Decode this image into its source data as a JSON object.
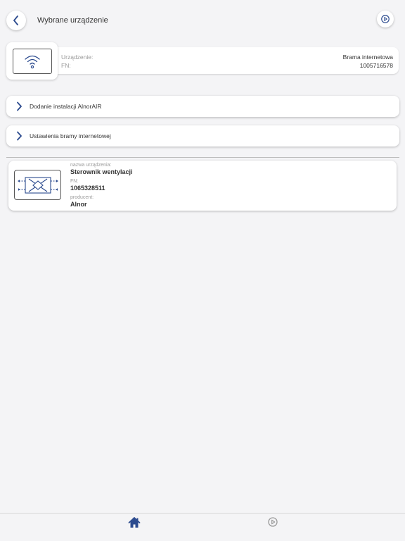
{
  "header": {
    "title": "Wybrane urządzenie",
    "back_icon": "chevron-left-icon",
    "settings_icon": "settings-gear-icon"
  },
  "gateway": {
    "icon": "wifi-icon",
    "device_label": "Urządzenie:",
    "device_value": "Brama internetowa",
    "fn_label": "FN:",
    "fn_value": "1005716578"
  },
  "actions": [
    {
      "label": "Dodanie instalacji AlnorAIR",
      "icon": "chevron-right-icon"
    },
    {
      "label": "Ustawienia bramy internetowej",
      "icon": "chevron-right-icon"
    }
  ],
  "device": {
    "icon": "ventilation-unit-icon",
    "name_label": "nazwa urządzenia:",
    "name_value": "Sterownik wentylacji",
    "fn_label": "FN:",
    "fn_value": "1065328511",
    "producer_label": "producent:",
    "producer_value": "Alnor"
  },
  "tabbar": {
    "home_icon": "home-icon",
    "settings_icon": "settings-gear-icon"
  },
  "colors": {
    "accent": "#2b4a8e",
    "background": "#f4f4f6",
    "inactive_icon": "#9a9a9a"
  }
}
